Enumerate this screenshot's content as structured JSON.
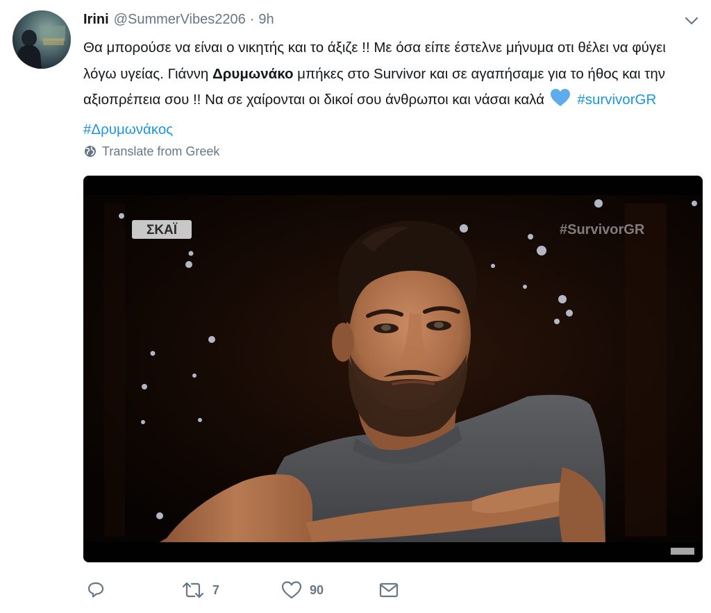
{
  "tweet": {
    "author_name": "Irini",
    "author_handle": "@SummerVibes2206",
    "separator": "·",
    "time": "9h",
    "text_part1": "Θα μπορούσε να είναι ο νικητής και το άξιζε !! Με όσα είπε έστελνε μήνυμα οτι θέλει να φύγει λόγω υγείας. Γιάννη ",
    "text_bold": "Δρυμωνάκο",
    "text_part2": " μπήκες στο Survivor και σε αγαπήσαμε για το ήθος και την αξιοπρέπεια σου !! Να σε χαίρονται οι δικοί σου άνθρωποι και νάσαι καλά",
    "hashtags": [
      "#survivorGR",
      "#Δρυμωνάκος"
    ],
    "translate_label": "Translate from Greek",
    "media": {
      "channel_logo": "ΣΚΑΪ",
      "watermark": "#SurvivorGR"
    },
    "actions": {
      "reply_count": "",
      "retweet_count": "7",
      "like_count": "90"
    },
    "icons": {
      "reply": "reply-icon",
      "retweet": "retweet-icon",
      "like": "heart-icon",
      "dm": "envelope-icon",
      "caret": "chevron-down-icon",
      "globe": "globe-icon",
      "emoji": "blue-heart-emoji"
    },
    "colors": {
      "text": "#14171a",
      "secondary": "#657786",
      "link": "#1b95e0",
      "emoji_heart": "#5dadec"
    }
  }
}
